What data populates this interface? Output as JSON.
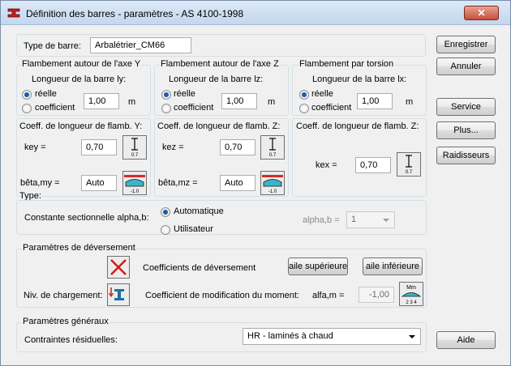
{
  "window": {
    "title": "Définition des barres - paramètres - AS 4100-1998",
    "close_label": "✕"
  },
  "member_type": {
    "label": "Type de barre:",
    "value": "Arbalétrier_CM66"
  },
  "buckling_y": {
    "title": "Flambement autour de l'axe Y",
    "length_label": "Longueur de la barre ly:",
    "option_real": "réelle",
    "option_coef": "coefficient",
    "length_value": "1,00",
    "unit": "m",
    "coef_title": "Coeff. de longueur de flamb. Y:",
    "k_label": "key =",
    "k_value": "0,70",
    "k_icon_value": "0.7",
    "beta_label": "bêta,my =",
    "beta_value": "Auto",
    "beta_icon_value": "-1.0",
    "selected": "réelle"
  },
  "buckling_z": {
    "title": "Flambement autour de l'axe Z",
    "length_label": "Longueur de la barre lz:",
    "option_real": "réelle",
    "option_coef": "coefficient",
    "length_value": "1,00",
    "unit": "m",
    "coef_title": "Coeff. de longueur de flamb. Z:",
    "k_label": "kez =",
    "k_value": "0,70",
    "k_icon_value": "0.7",
    "beta_label": "bêta,mz =",
    "beta_value": "Auto",
    "beta_icon_value": "-1.0",
    "selected": "réelle"
  },
  "buckling_x": {
    "title": "Flambement par torsion",
    "length_label": "Longueur de la barre lx:",
    "option_real": "réelle",
    "option_coef": "coefficient",
    "length_value": "1,00",
    "unit": "m",
    "coef_title": "Coeff. de longueur de flamb. Z:",
    "k_label": "kex =",
    "k_value": "0,70",
    "k_icon_value": "0.7",
    "selected": "réelle"
  },
  "type_label": "Type:",
  "alpha": {
    "label": "Constante sectionnelle alpha,b:",
    "option_auto": "Automatique",
    "option_user": "Utilisateur",
    "selected": "Automatique",
    "value_label": "alpha,b =",
    "value": "1"
  },
  "ltb": {
    "title": "Paramètres de déversement",
    "coef_label": "Coefficients de déversement",
    "upper_button": "aile supérieure",
    "lower_button": "aile inférieure",
    "load_level_label": "Niv. de chargement:",
    "moment_label": "Coefficient de modification du moment:",
    "alfa_label": "alfa,m =",
    "alfa_value": "-1,00",
    "moment_icon_top": "Mm",
    "moment_icon_bottom": "2 3 4"
  },
  "general": {
    "title": "Paramètres généraux",
    "residual_label": "Contraintes résiduelles:",
    "residual_value": "HR - laminés à chaud"
  },
  "side_buttons": {
    "save": "Enregistrer",
    "cancel": "Annuler",
    "service": "Service",
    "more": "Plus...",
    "stiffeners": "Raidisseurs",
    "help": "Aide"
  },
  "colors": {
    "accent_radio": "#1d5aab",
    "close_button": "#c7503a",
    "error_cross": "#d21a1a"
  }
}
